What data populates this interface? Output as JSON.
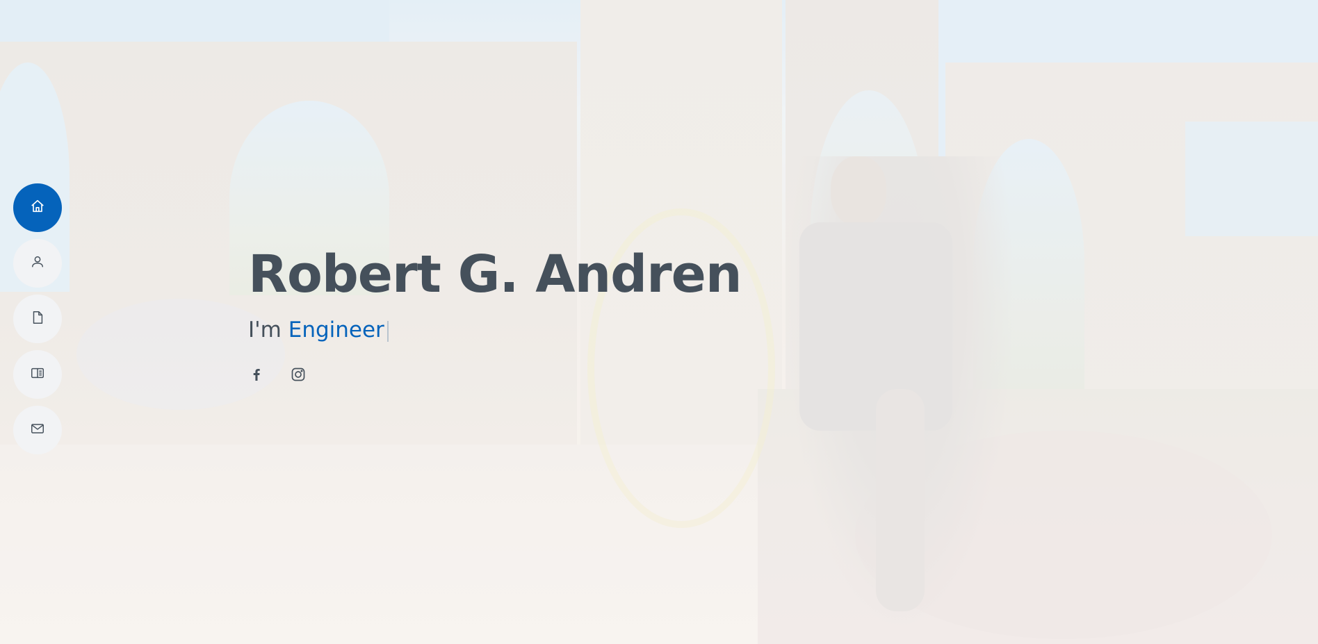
{
  "hero": {
    "name": "Robert G. Andren",
    "tagline_prefix": "I'm",
    "typed_role": "Engineer",
    "background_image": "outdoor-ruins-graffiti-photo"
  },
  "nav": {
    "items": [
      {
        "id": "home",
        "icon": "house-icon",
        "active": true
      },
      {
        "id": "about",
        "icon": "person-icon",
        "active": false
      },
      {
        "id": "resume",
        "icon": "file-icon",
        "active": false
      },
      {
        "id": "portfolio",
        "icon": "book-icon",
        "active": false
      },
      {
        "id": "contact",
        "icon": "envelope-icon",
        "active": false
      }
    ]
  },
  "social": [
    {
      "name": "facebook",
      "icon": "facebook-icon"
    },
    {
      "name": "instagram",
      "icon": "instagram-icon"
    }
  ],
  "colors": {
    "accent": "#0563bb",
    "text": "#45505b",
    "nav_bg": "#f2f3f5"
  }
}
